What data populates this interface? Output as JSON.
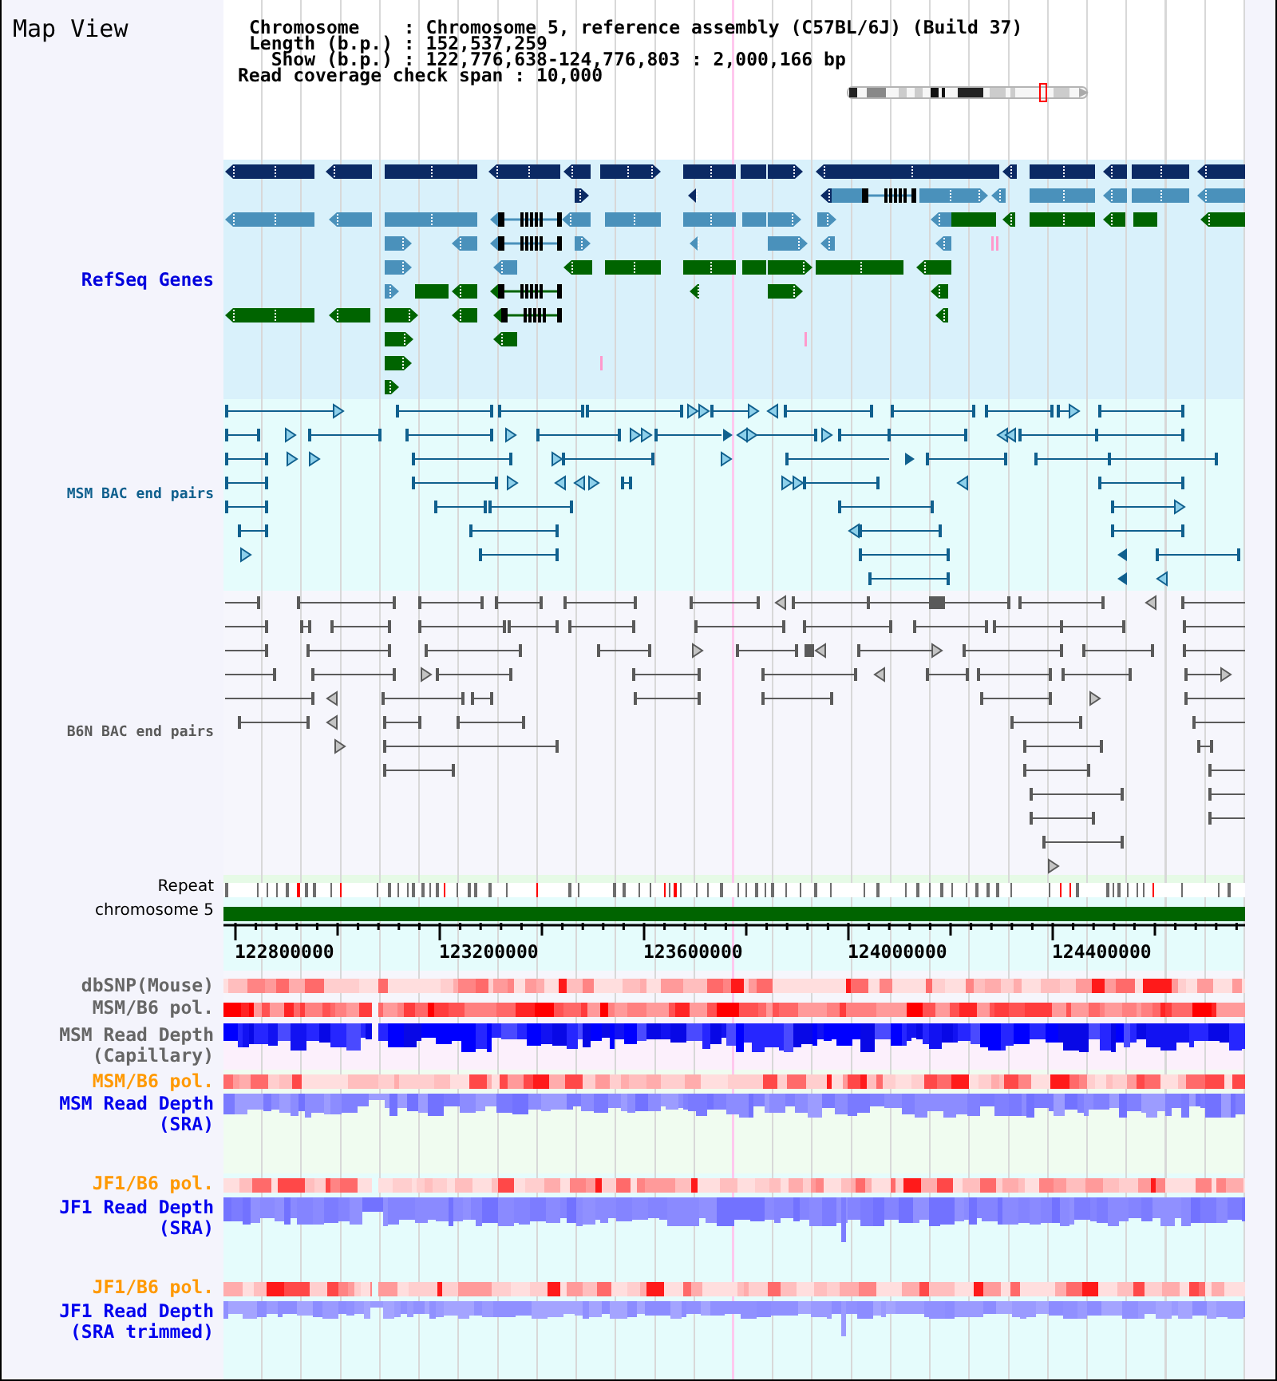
{
  "view": {
    "title": "Map View"
  },
  "info": {
    "rows": [
      {
        "label": "Chromosome",
        "colon": ":",
        "value": "Chromosome 5, reference assembly (C57BL/6J) (Build 37)"
      },
      {
        "label": "Length (b.p.)",
        "colon": ":",
        "value": "152,537,259"
      },
      {
        "label": "Show (b.p.)",
        "colon": ":",
        "value": "122,776,638-124,776,803 : 2,000,166 bp"
      }
    ],
    "span": {
      "label": "Read coverage check span",
      "colon": ":",
      "value": "10,000"
    }
  },
  "tracks": [
    {
      "kind": "genes",
      "label": "RefSeq Genes",
      "color": "#0000dd"
    },
    {
      "kind": "bac_pairs",
      "label": "MSM BAC end pairs",
      "color": "#10608e"
    },
    {
      "kind": "bac_pairs",
      "label": "B6N BAC end pairs",
      "color": "#5a5a5a"
    },
    {
      "kind": "repeat",
      "label": "Repeat",
      "color": "#000000"
    },
    {
      "kind": "chromosome",
      "label": "chromosome 5",
      "color": "#000000"
    },
    {
      "kind": "ruler",
      "ticks": [
        "122800000",
        "123200000",
        "123600000",
        "124000000",
        "124400000"
      ]
    },
    {
      "kind": "polymorphism",
      "label": "dbSNP(Mouse)",
      "color": "#666666"
    },
    {
      "kind": "polymorphism",
      "label": "MSM/B6 pol.",
      "color": "#666666"
    },
    {
      "kind": "depth",
      "label": "MSM Read Depth (Capillary)",
      "color": "#666666"
    },
    {
      "kind": "polymorphism",
      "label": "MSM/B6 pol.",
      "color": "#ff9900"
    },
    {
      "kind": "depth",
      "label": "MSM Read Depth (SRA)",
      "color": "#0000ee"
    },
    {
      "kind": "polymorphism",
      "label": "JF1/B6 pol.",
      "color": "#ff9900"
    },
    {
      "kind": "depth",
      "label": "JF1 Read Depth (SRA)",
      "color": "#0000ee"
    },
    {
      "kind": "polymorphism",
      "label": "JF1/B6 pol.",
      "color": "#ff9900"
    },
    {
      "kind": "depth",
      "label": "JF1 Read Depth (SRA trimmed)",
      "color": "#0000ee"
    }
  ]
}
